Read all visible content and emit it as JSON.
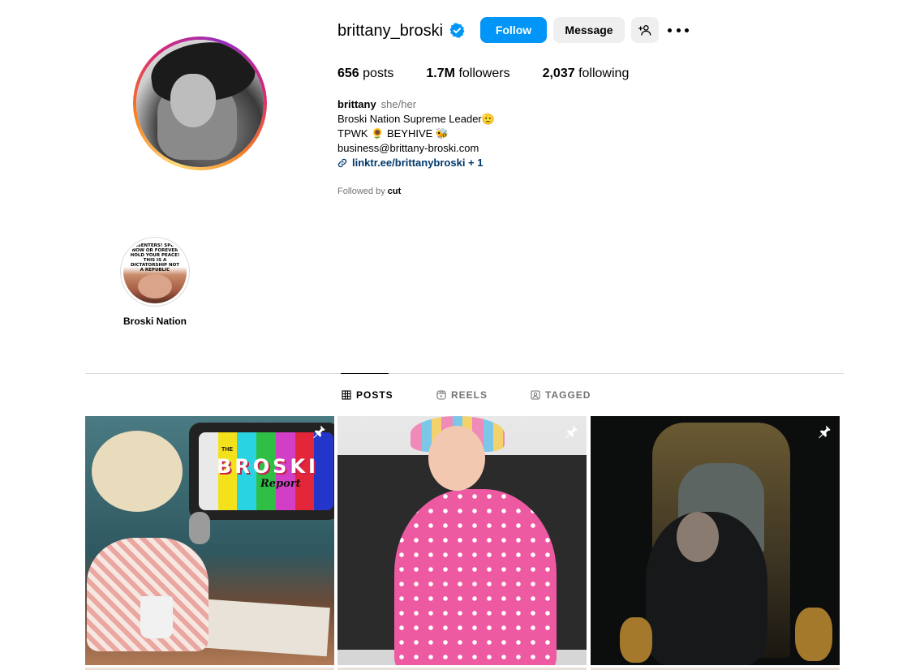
{
  "profile": {
    "username": "brittany_broski",
    "verified": true,
    "buttons": {
      "follow": "Follow",
      "message": "Message"
    },
    "stats": {
      "posts_value": "656",
      "posts_label": "posts",
      "followers_value": "1.7M",
      "followers_label": "followers",
      "following_value": "2,037",
      "following_label": "following"
    },
    "bio": {
      "name": "brittany",
      "pronouns": "she/her",
      "line1": "Broski Nation Supreme Leader🫡",
      "line2": "TPWK 🌻 BEYHIVE 🐝",
      "line3": "business@brittany-broski.com",
      "link": "linktr.ee/brittanybroski + 1"
    },
    "followed_by_prefix": "Followed by ",
    "followed_by_user": "cut"
  },
  "highlights": [
    {
      "label": "Broski Nation",
      "cover_text": "DISSENTERS! SPEAK NOW OR FOREVER HOLD YOUR PEACE! THIS IS A DICTATORSHIP NOT A REPUBLIC"
    }
  ],
  "tabs": [
    {
      "label": "POSTS",
      "icon": "grid-icon",
      "active": true
    },
    {
      "label": "REELS",
      "icon": "reels-icon",
      "active": false
    },
    {
      "label": "TAGGED",
      "icon": "tagged-icon",
      "active": false
    }
  ],
  "posts": [
    {
      "pinned": true,
      "text_the": "THE",
      "text_title": "BROSKI",
      "text_sub": "Report"
    },
    {
      "pinned": true
    },
    {
      "pinned": true
    }
  ],
  "colors": {
    "follow_button": "#0095f6",
    "secondary_button": "#efefef",
    "link": "#00376b",
    "muted_text": "#737373",
    "divider": "#dbdbdb"
  }
}
